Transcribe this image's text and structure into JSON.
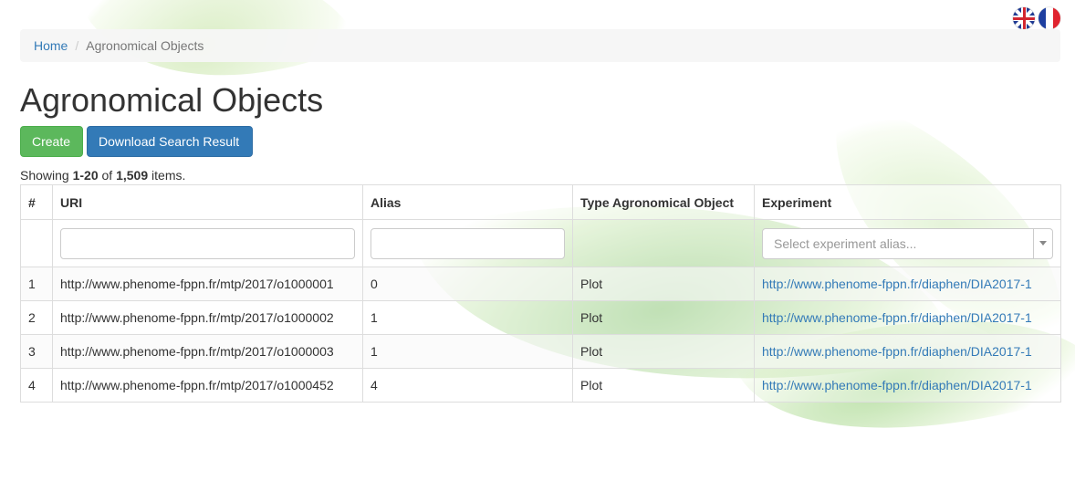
{
  "languages": [
    {
      "code": "en",
      "icon": "uk-flag-icon"
    },
    {
      "code": "fr",
      "icon": "fr-flag-icon"
    }
  ],
  "breadcrumb": {
    "home": "Home",
    "current": "Agronomical Objects"
  },
  "page_title": "Agronomical Objects",
  "toolbar": {
    "create_label": "Create",
    "download_label": "Download Search Result"
  },
  "summary": {
    "prefix": "Showing ",
    "range": "1-20",
    "of": " of ",
    "total": "1,509",
    "suffix": " items."
  },
  "table": {
    "columns": [
      "#",
      "URI",
      "Alias",
      "Type Agronomical Object",
      "Experiment"
    ],
    "filters": {
      "uri_value": "",
      "alias_value": "",
      "experiment_placeholder": "Select experiment alias..."
    },
    "rows": [
      {
        "n": "1",
        "uri": "http://www.phenome-fppn.fr/mtp/2017/o1000001",
        "alias": "0",
        "type": "Plot",
        "experiment": "http://www.phenome-fppn.fr/diaphen/DIA2017-1"
      },
      {
        "n": "2",
        "uri": "http://www.phenome-fppn.fr/mtp/2017/o1000002",
        "alias": "1",
        "type": "Plot",
        "experiment": "http://www.phenome-fppn.fr/diaphen/DIA2017-1"
      },
      {
        "n": "3",
        "uri": "http://www.phenome-fppn.fr/mtp/2017/o1000003",
        "alias": "1",
        "type": "Plot",
        "experiment": "http://www.phenome-fppn.fr/diaphen/DIA2017-1"
      },
      {
        "n": "4",
        "uri": "http://www.phenome-fppn.fr/mtp/2017/o1000452",
        "alias": "4",
        "type": "Plot",
        "experiment": "http://www.phenome-fppn.fr/diaphen/DIA2017-1"
      }
    ]
  },
  "colors": {
    "link": "#337ab7",
    "create_button": "#5cb85c",
    "download_button": "#337ab7"
  }
}
